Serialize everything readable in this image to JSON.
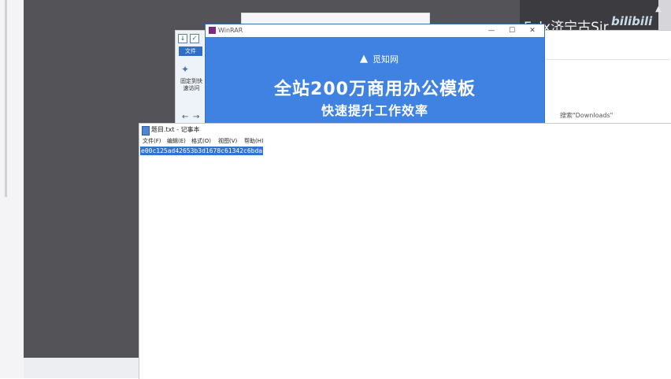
{
  "watermark": {
    "text": "Felx济宁古Sir",
    "logo": "bilibili"
  },
  "explorer": {
    "file_tab": "文件",
    "pin_label": "固定到快速访问",
    "search_placeholder": "搜索\"Downloads\""
  },
  "winrar": {
    "title": "WinRAR",
    "ad": {
      "brand": "觅知网",
      "line1": "全站200万商用办公模板",
      "line2": "快速提升工作效率"
    }
  },
  "notepad": {
    "title": "题目.txt - 记事本",
    "menu": [
      {
        "label": "文件(F)"
      },
      {
        "label": "编辑(E)"
      },
      {
        "label": "格式(O)"
      },
      {
        "label": "视图(V)"
      },
      {
        "label": "帮助(H)"
      }
    ],
    "content": "e00c125ad42653b3d1678c61342c6bda"
  },
  "colors": {
    "desktop": "#545458",
    "winrar_ad_bg": "#3f82e2",
    "selection": "#2f73d3"
  },
  "icons": [
    "download-icon",
    "check-icon",
    "pin-icon",
    "back-arrow-icon",
    "forward-arrow-icon",
    "notepad-icon",
    "winrar-icon",
    "minimize-icon",
    "maximize-icon",
    "close-icon",
    "scroll-up-icon"
  ]
}
